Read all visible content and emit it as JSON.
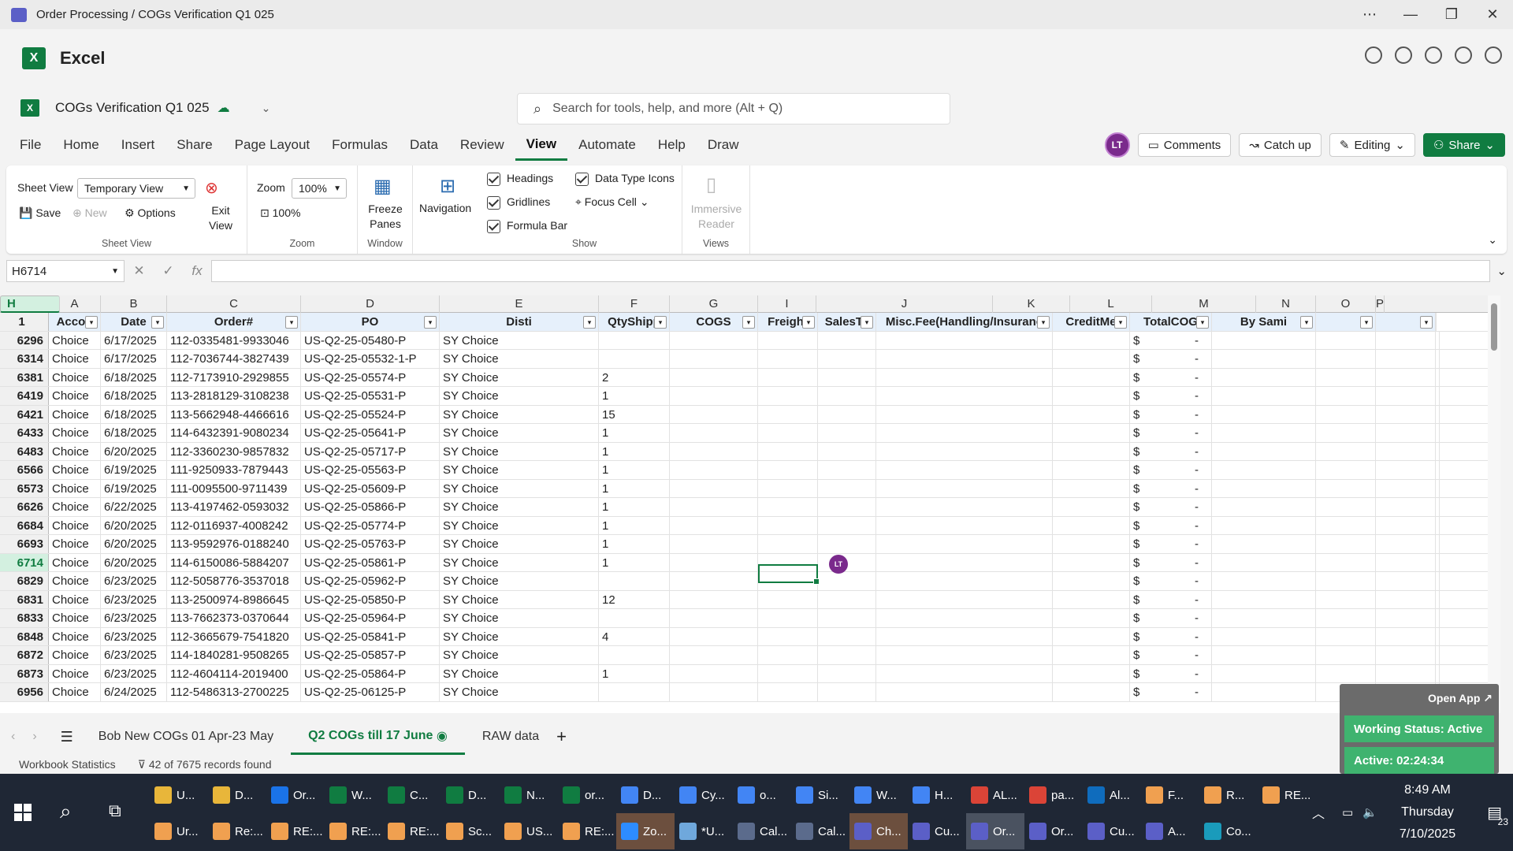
{
  "window": {
    "title": "Order Processing / COGs Verification Q1 025"
  },
  "app": {
    "name": "Excel",
    "logo_letter": "X"
  },
  "document": {
    "name": "COGs Verification Q1 025"
  },
  "search": {
    "placeholder": "Search for tools, help, and more (Alt + Q)"
  },
  "menu": {
    "tabs": [
      "File",
      "Home",
      "Insert",
      "Share",
      "Page Layout",
      "Formulas",
      "Data",
      "Review",
      "View",
      "Automate",
      "Help",
      "Draw"
    ],
    "active": "View"
  },
  "header_actions": {
    "avatar": "LT",
    "comments": "Comments",
    "catch_up": "Catch up",
    "editing": "Editing",
    "share": "Share"
  },
  "ribbon": {
    "sheet_view": {
      "label": "Sheet View",
      "value": "Temporary View",
      "save": "Save",
      "new": "New",
      "options": "Options",
      "exit": "Exit View",
      "group": "Sheet View"
    },
    "zoom": {
      "label": "Zoom",
      "value": "100%",
      "reset": "100%",
      "group": "Zoom"
    },
    "window": {
      "freeze": "Freeze Panes",
      "group": "Window"
    },
    "navigation": {
      "label": "Navigation"
    },
    "show": {
      "headings": "Headings",
      "gridlines": "Gridlines",
      "formula_bar": "Formula Bar",
      "data_type_icons": "Data Type Icons",
      "focus_cell": "Focus Cell",
      "group": "Show"
    },
    "views": {
      "immersive": "Immersive Reader",
      "group": "Views"
    }
  },
  "formula_bar": {
    "name_box": "H6714",
    "fx": "fx",
    "value": ""
  },
  "grid": {
    "columns": [
      "A",
      "B",
      "C",
      "D",
      "E",
      "F",
      "G",
      "H",
      "I",
      "J",
      "K",
      "L",
      "M",
      "N",
      "O",
      "P"
    ],
    "selected_column": "H",
    "header_row": {
      "row": "1",
      "cells": [
        "Accou",
        "Date",
        "Order#",
        "PO",
        "Disti",
        "QtyShipp",
        "COGS",
        "Freight",
        "SalesTa",
        "Misc.Fee(Handling/Insuranc",
        "CreditMe",
        "TotalCOG",
        "By Sami",
        "",
        ""
      ]
    },
    "rows": [
      {
        "n": "6296",
        "a": "Choice",
        "b": "6/17/2025",
        "c": "112-0335481-9933046",
        "d": "US-Q2-25-05480-P",
        "e": "SY Choice",
        "f": ""
      },
      {
        "n": "6314",
        "a": "Choice",
        "b": "6/17/2025",
        "c": "112-7036744-3827439",
        "d": "US-Q2-25-05532-1-P",
        "e": "SY Choice",
        "f": ""
      },
      {
        "n": "6381",
        "a": "Choice",
        "b": "6/18/2025",
        "c": "112-7173910-2929855",
        "d": "US-Q2-25-05574-P",
        "e": "SY Choice",
        "f": "2"
      },
      {
        "n": "6419",
        "a": "Choice",
        "b": "6/18/2025",
        "c": "113-2818129-3108238",
        "d": "US-Q2-25-05531-P",
        "e": "SY Choice",
        "f": "1"
      },
      {
        "n": "6421",
        "a": "Choice",
        "b": "6/18/2025",
        "c": "113-5662948-4466616",
        "d": "US-Q2-25-05524-P",
        "e": "SY Choice",
        "f": "15"
      },
      {
        "n": "6433",
        "a": "Choice",
        "b": "6/18/2025",
        "c": "114-6432391-9080234",
        "d": "US-Q2-25-05641-P",
        "e": "SY Choice",
        "f": "1"
      },
      {
        "n": "6483",
        "a": "Choice",
        "b": "6/20/2025",
        "c": "112-3360230-9857832",
        "d": "US-Q2-25-05717-P",
        "e": "SY Choice",
        "f": "1"
      },
      {
        "n": "6566",
        "a": "Choice",
        "b": "6/19/2025",
        "c": "111-9250933-7879443",
        "d": "US-Q2-25-05563-P",
        "e": "SY Choice",
        "f": "1"
      },
      {
        "n": "6573",
        "a": "Choice",
        "b": "6/19/2025",
        "c": "111-0095500-9711439",
        "d": "US-Q2-25-05609-P",
        "e": "SY Choice",
        "f": "1"
      },
      {
        "n": "6626",
        "a": "Choice",
        "b": "6/22/2025",
        "c": "113-4197462-0593032",
        "d": "US-Q2-25-05866-P",
        "e": "SY Choice",
        "f": "1"
      },
      {
        "n": "6684",
        "a": "Choice",
        "b": "6/20/2025",
        "c": "112-0116937-4008242",
        "d": "US-Q2-25-05774-P",
        "e": "SY Choice",
        "f": "1"
      },
      {
        "n": "6693",
        "a": "Choice",
        "b": "6/20/2025",
        "c": "113-9592976-0188240",
        "d": "US-Q2-25-05763-P",
        "e": "SY Choice",
        "f": "1"
      },
      {
        "n": "6714",
        "a": "Choice",
        "b": "6/20/2025",
        "c": "114-6150086-5884207",
        "d": "US-Q2-25-05861-P",
        "e": "SY Choice",
        "f": "1"
      },
      {
        "n": "6829",
        "a": "Choice",
        "b": "6/23/2025",
        "c": "112-5058776-3537018",
        "d": "US-Q2-25-05962-P",
        "e": "SY Choice",
        "f": ""
      },
      {
        "n": "6831",
        "a": "Choice",
        "b": "6/23/2025",
        "c": "113-2500974-8986645",
        "d": "US-Q2-25-05850-P",
        "e": "SY Choice",
        "f": "12"
      },
      {
        "n": "6833",
        "a": "Choice",
        "b": "6/23/2025",
        "c": "113-7662373-0370644",
        "d": "US-Q2-25-05964-P",
        "e": "SY Choice",
        "f": ""
      },
      {
        "n": "6848",
        "a": "Choice",
        "b": "6/23/2025",
        "c": "112-3665679-7541820",
        "d": "US-Q2-25-05841-P",
        "e": "SY Choice",
        "f": "4"
      },
      {
        "n": "6872",
        "a": "Choice",
        "b": "6/23/2025",
        "c": "114-1840281-9508265",
        "d": "US-Q2-25-05857-P",
        "e": "SY Choice",
        "f": ""
      },
      {
        "n": "6873",
        "a": "Choice",
        "b": "6/23/2025",
        "c": "112-4604114-2019400",
        "d": "US-Q2-25-05864-P",
        "e": "SY Choice",
        "f": "1"
      },
      {
        "n": "6956",
        "a": "Choice",
        "b": "6/24/2025",
        "c": "112-5486313-2700225",
        "d": "US-Q2-25-06125-P",
        "e": "SY Choice",
        "f": ""
      }
    ],
    "total_cogs_symbol": "$",
    "total_cogs_value": "-",
    "active_row": "6714",
    "presence_avatar": "LT"
  },
  "sheets": {
    "tabs": [
      "Bob New COGs 01 Apr-23 May",
      "Q2 COGs till 17 June",
      "RAW data"
    ],
    "active": "Q2 COGs till 17 June",
    "add": "+"
  },
  "status": {
    "workbook_statistics": "Workbook Statistics",
    "records": "42 of 7675 records found"
  },
  "widget": {
    "open_app": "Open App ↗",
    "working_status": "Working Status: Active",
    "active_timer": "Active: 02:24:34"
  },
  "taskbar": {
    "row1": [
      "U...",
      "D...",
      "Or...",
      "W...",
      "C...",
      "D...",
      "N...",
      "or...",
      "D...",
      "Cy...",
      "o...",
      "Si...",
      "W...",
      "H...",
      "AL...",
      "pa...",
      "Al...",
      "F...",
      "R...",
      "RE..."
    ],
    "row2": [
      "Ur...",
      "Re:...",
      "RE:...",
      "RE:...",
      "RE:...",
      "Sc...",
      "US...",
      "RE:...",
      "Zo...",
      "*U...",
      "Cal...",
      "Cal...",
      "Ch...",
      "Cu...",
      "Or...",
      "Or...",
      "Cu...",
      "A...",
      "Co..."
    ],
    "time": "8:49 AM",
    "day": "Thursday",
    "date": "7/10/2025",
    "notifications": "23"
  }
}
